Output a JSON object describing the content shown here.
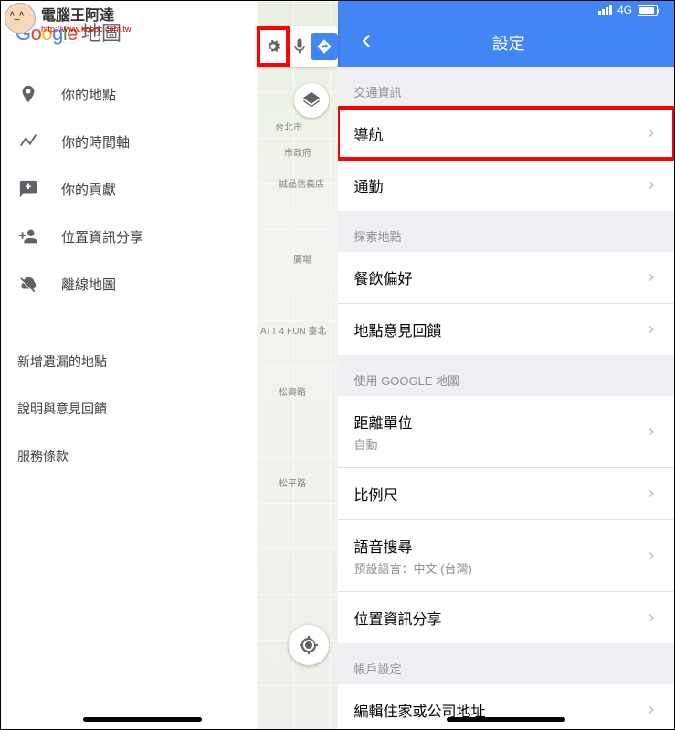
{
  "watermark": {
    "title": "電腦王阿達",
    "url": "http://www.kocpc.com.tw"
  },
  "left": {
    "logo": {
      "g1": "G",
      "o1": "o",
      "o2": "o",
      "g2": "g",
      "l": "l",
      "e": "e",
      "app": "地圖"
    },
    "menu": [
      {
        "key": "your-places",
        "icon": "pin",
        "label": "你的地點"
      },
      {
        "key": "timeline",
        "icon": "timeline",
        "label": "你的時間軸"
      },
      {
        "key": "contributions",
        "icon": "chat-add",
        "label": "你的貢獻"
      },
      {
        "key": "location-sharing",
        "icon": "person-add",
        "label": "位置資訊分享"
      },
      {
        "key": "offline-maps",
        "icon": "cloud-off",
        "label": "離線地圖"
      }
    ],
    "secondary": [
      {
        "key": "add-missing",
        "label": "新增遺漏的地點"
      },
      {
        "key": "help-feedback",
        "label": "說明與意見回饋"
      },
      {
        "key": "terms",
        "label": "服務條款"
      }
    ],
    "map": {
      "l1": "台北市",
      "l2": "市政府",
      "l3": "誠品信義店",
      "l4": "廣場",
      "l5": "ATT 4 FUN 臺北",
      "l6": "松壽路",
      "l7": "松平路"
    }
  },
  "right": {
    "status": {
      "network": "4G"
    },
    "header": {
      "title": "設定"
    },
    "sections": [
      {
        "header": "交通資訊",
        "items": [
          {
            "key": "navigation",
            "title": "導航",
            "highlight": true
          },
          {
            "key": "commute",
            "title": "通勤"
          }
        ]
      },
      {
        "header": "探索地點",
        "items": [
          {
            "key": "dining-pref",
            "title": "餐飲偏好"
          },
          {
            "key": "place-feedback",
            "title": "地點意見回饋"
          }
        ]
      },
      {
        "header": "使用 GOOGLE 地圖",
        "items": [
          {
            "key": "distance-unit",
            "title": "距離單位",
            "sub": "自動"
          },
          {
            "key": "scale",
            "title": "比例尺"
          },
          {
            "key": "voice-search",
            "title": "語音搜尋",
            "sub": "預設語言：中文 (台灣)"
          },
          {
            "key": "loc-sharing",
            "title": "位置資訊分享"
          }
        ]
      },
      {
        "header": "帳戶設定",
        "items": [
          {
            "key": "edit-addr",
            "title": "編輯住家或公司地址"
          }
        ]
      }
    ]
  }
}
